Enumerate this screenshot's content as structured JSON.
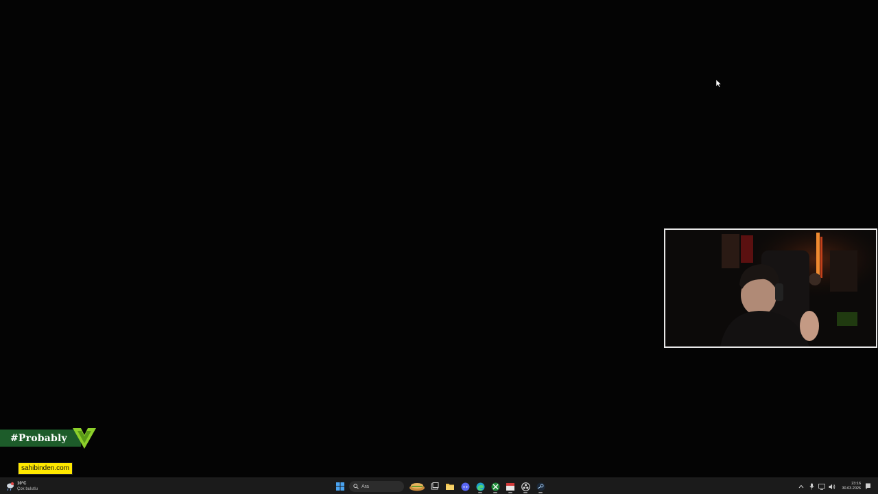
{
  "overlay": {
    "sponsor_tag": "#Probably",
    "sponsor_site": "sahibinden.com"
  },
  "taskbar": {
    "weather": {
      "temperature": "10°C",
      "condition": "Çok bulutlu",
      "icon": "cloud-rain-icon"
    },
    "search": {
      "label": "Ara",
      "icon": "search-icon"
    },
    "pinned_apps": [
      {
        "name": "start",
        "icon": "windows-start-icon"
      },
      {
        "name": "widgets",
        "icon": "widgets-icon"
      },
      {
        "name": "task-view",
        "icon": "task-view-icon"
      },
      {
        "name": "file-explorer",
        "icon": "folder-icon"
      },
      {
        "name": "discord",
        "icon": "discord-icon"
      },
      {
        "name": "edge",
        "icon": "edge-icon",
        "active": true
      },
      {
        "name": "xbox",
        "icon": "xbox-icon"
      },
      {
        "name": "calendar-app",
        "icon": "calendar-icon"
      },
      {
        "name": "obs",
        "icon": "obs-icon"
      },
      {
        "name": "steam",
        "icon": "steam-icon"
      }
    ],
    "tray": {
      "icons": [
        "chevron-up-icon",
        "microphone-icon",
        "network-icon",
        "volume-icon"
      ],
      "time": "23:16",
      "date": "30.03.2026",
      "notification_icon": "notification-icon"
    }
  },
  "colors": {
    "desktop": "#040404",
    "taskbar": "#1b1b1b",
    "sponsor_green": "#1d5c2a",
    "sponsor_yellow": "#ffe800",
    "logo_green": "#8ccf2a"
  }
}
